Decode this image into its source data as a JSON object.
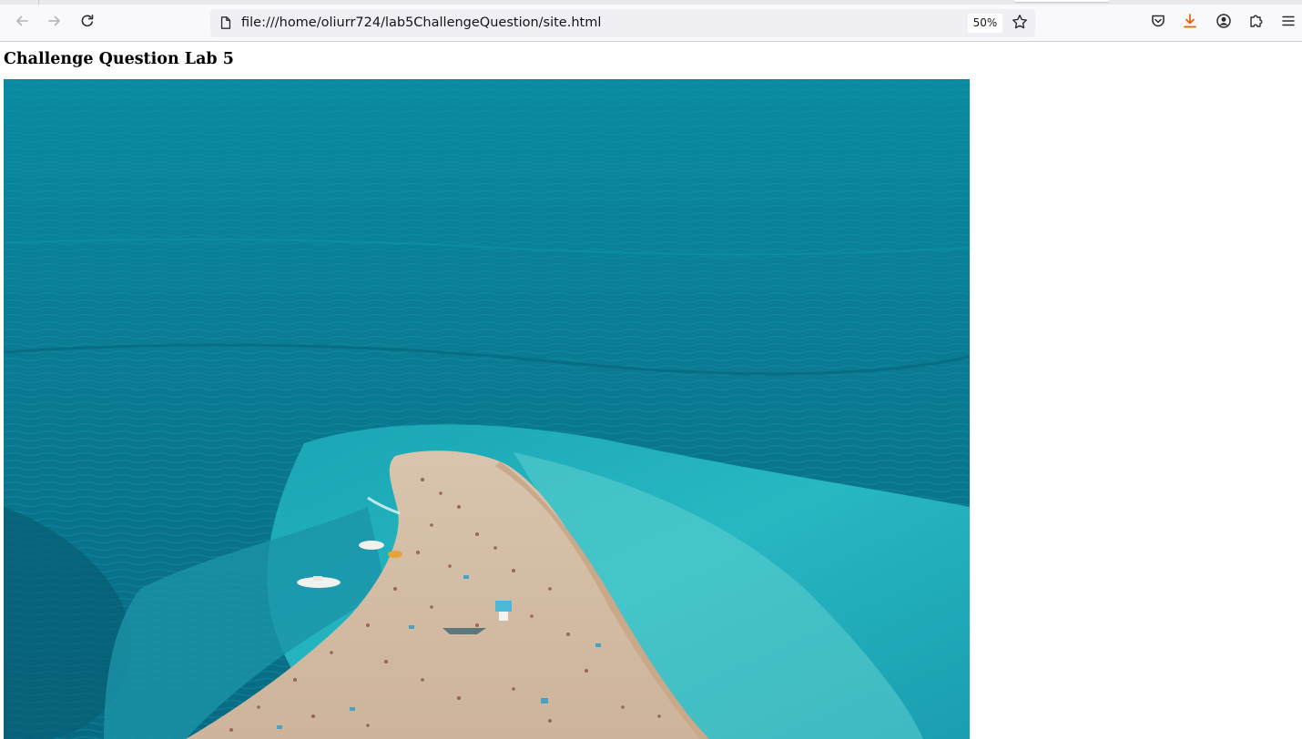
{
  "browser": {
    "url": "file:///home/oliurr724/lab5ChallengeQuestion/site.html",
    "zoom": "50%",
    "icons": {
      "back": "arrow-left-icon",
      "forward": "arrow-right-icon",
      "reload": "reload-icon",
      "page": "page-icon",
      "bookmark": "star-icon",
      "pocket": "pocket-icon",
      "downloads": "download-icon",
      "account": "account-icon",
      "extensions": "puzzle-icon",
      "menu": "hamburger-menu-icon"
    },
    "colors": {
      "download_accent": "#e66000",
      "toolbar_bg": "#f9f9fb",
      "urlbar_bg": "#f0f0f4"
    }
  },
  "page": {
    "heading": "Challenge Question Lab 5",
    "image": {
      "subject": "aerial-beach-photo",
      "colors": {
        "deep_sea": "#0a6f88",
        "shallow_water": "#2bb8c4",
        "sand": "#d9c2a8"
      }
    }
  }
}
